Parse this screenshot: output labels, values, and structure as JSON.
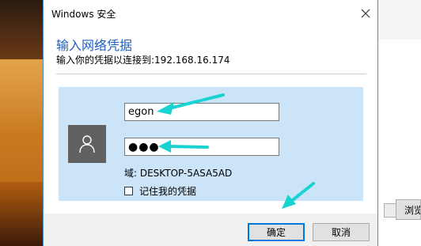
{
  "window": {
    "title": "Windows 安全",
    "close_icon": "close-icon"
  },
  "dialog": {
    "heading": "输入网络凭据",
    "subtext": "输入你的凭据以连接到:192.168.16.174"
  },
  "credentials": {
    "avatar_icon": "user-icon",
    "username_value": "egon",
    "password_value": "●●●",
    "domain_text": "域: DESKTOP-5ASA5AD",
    "remember_label": "记住我的凭据",
    "remember_checked": false
  },
  "buttons": {
    "ok_label": "确定",
    "cancel_label": "取消"
  },
  "background": {
    "browse_label": "浏览"
  },
  "colors": {
    "heading": "#1f5fbf",
    "panel": "#cce4f7",
    "annotation_arrow": "#19d3d3",
    "ok_border": "#0078d7"
  }
}
